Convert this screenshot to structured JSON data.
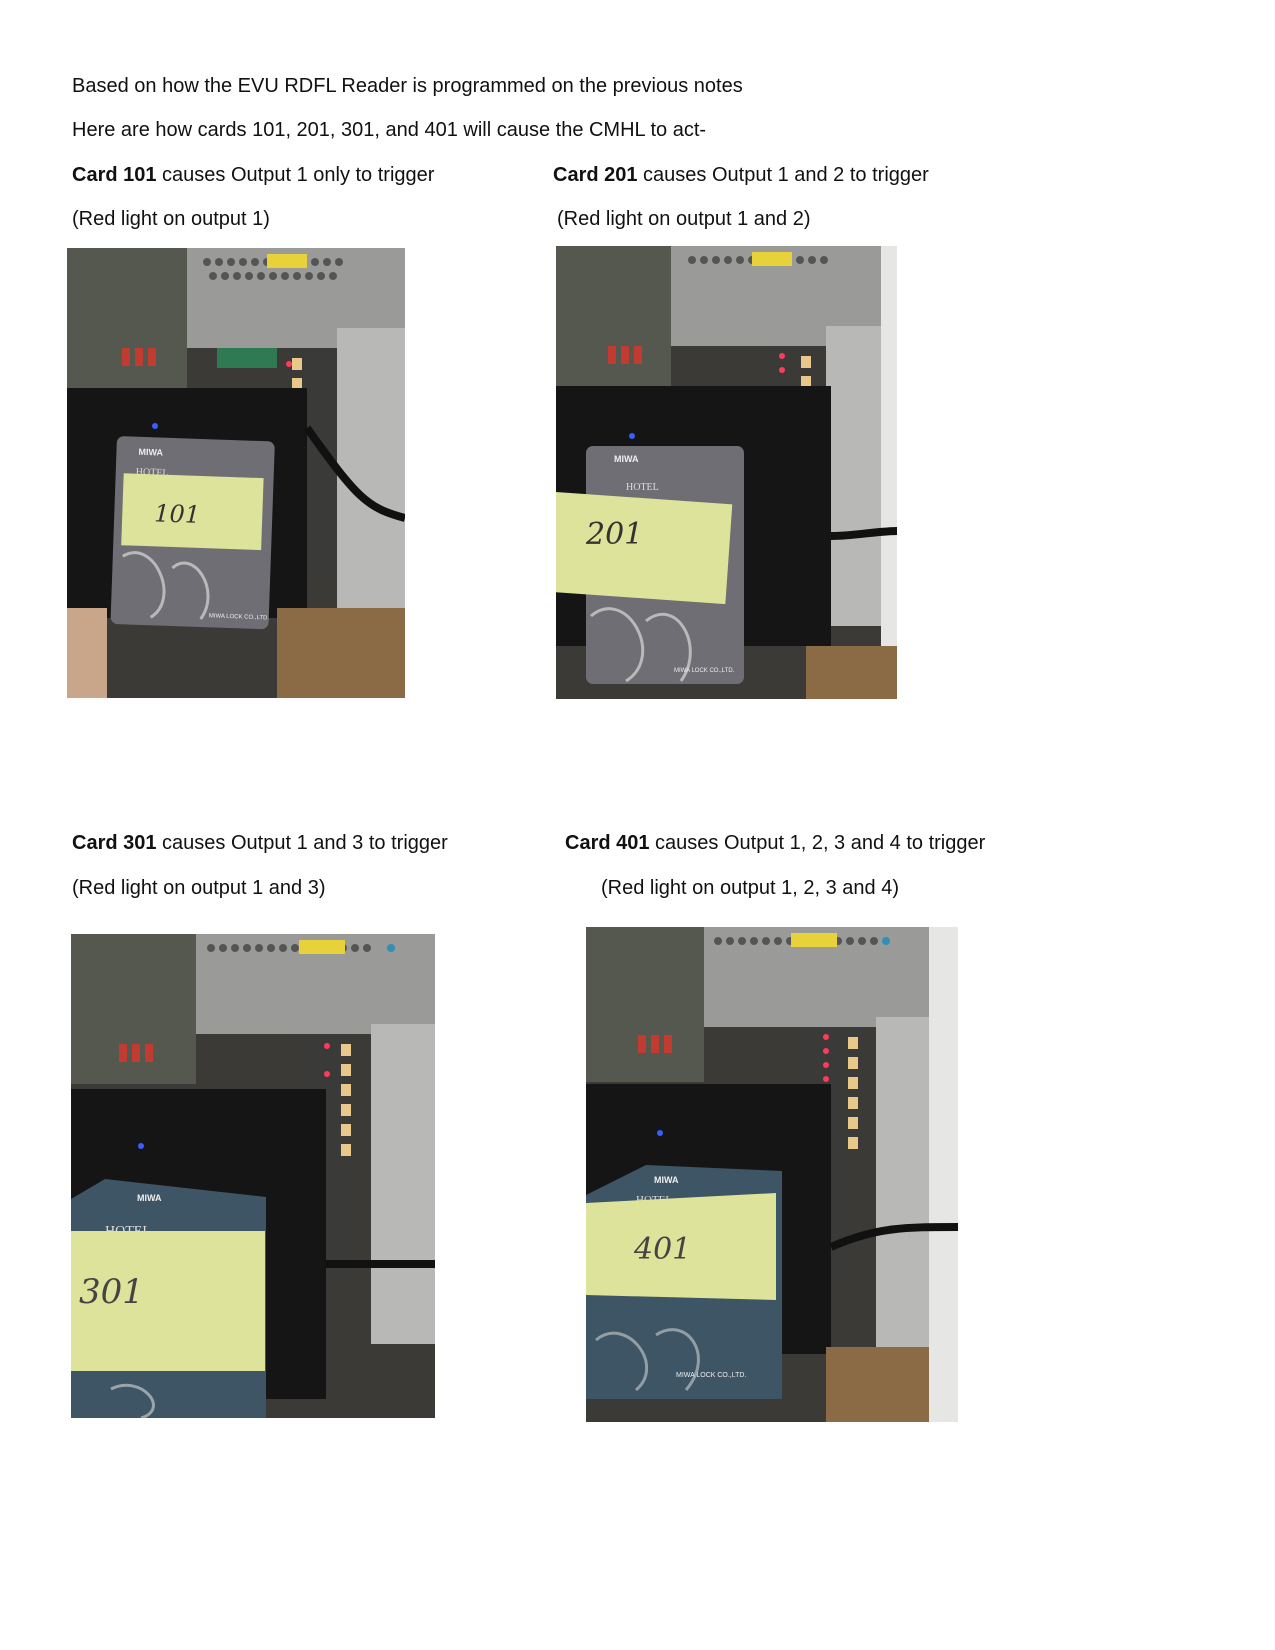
{
  "intro": {
    "line1": "Based on how the EVU RDFL Reader is programmed on the previous notes",
    "line2": "Here are how cards 101, 201, 301, and 401 will cause the CMHL to act-"
  },
  "cards": [
    {
      "label": "Card 101",
      "text": " causes Output 1 only to trigger",
      "note": "(Red light on output 1)",
      "handwriting": "101",
      "card_brand": "MIWA",
      "card_hotel": "HOTEL",
      "card_maker": "MIWA LOCK CO.,LTD."
    },
    {
      "label": "Card 201",
      "text": " causes Output 1 and 2 to trigger",
      "note": "(Red light on output 1 and 2)",
      "handwriting": "201",
      "card_brand": "MIWA",
      "card_hotel": "HOTEL",
      "card_maker": "MIWA LOCK CO.,LTD."
    },
    {
      "label": "Card 301",
      "text": " causes Output 1 and 3 to trigger",
      "note": "(Red light on output 1 and 3)",
      "handwriting": "301",
      "card_brand": "MIWA",
      "card_hotel": "HOTEL",
      "card_maker": ""
    },
    {
      "label": "Card 401",
      "text": " causes Output 1, 2, 3 and 4 to trigger",
      "note": "(Red light on output 1, 2, 3 and 4)",
      "handwriting": "401",
      "card_brand": "MIWA",
      "card_hotel": "HOTEL",
      "card_maker": "MIWA LOCK CO.,LTD."
    }
  ],
  "colors": {
    "card_gray": "#6e6e74",
    "card_blue": "#3e5565",
    "sticky_note": "#dde39a",
    "red_led": "#ff3b5c",
    "blue_led": "#3c5cff"
  }
}
